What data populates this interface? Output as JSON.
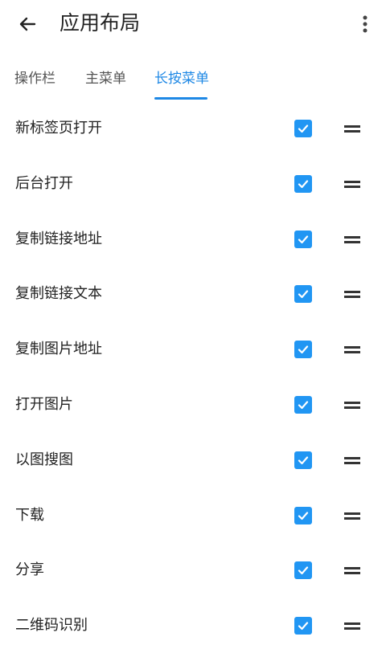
{
  "header": {
    "title": "应用布局",
    "back_icon": "arrow-left-icon",
    "menu_icon": "more-vertical-icon"
  },
  "tabs": [
    {
      "label": "操作栏",
      "active": false
    },
    {
      "label": "主菜单",
      "active": false
    },
    {
      "label": "长按菜单",
      "active": true
    }
  ],
  "colors": {
    "accent": "#1e88e5",
    "checkbox": "#2196f3"
  },
  "items": [
    {
      "label": "新标签页打开",
      "checked": true
    },
    {
      "label": "后台打开",
      "checked": true
    },
    {
      "label": "复制链接地址",
      "checked": true
    },
    {
      "label": "复制链接文本",
      "checked": true
    },
    {
      "label": "复制图片地址",
      "checked": true
    },
    {
      "label": "打开图片",
      "checked": true
    },
    {
      "label": "以图搜图",
      "checked": true
    },
    {
      "label": "下载",
      "checked": true
    },
    {
      "label": "分享",
      "checked": true
    },
    {
      "label": "二维码识别",
      "checked": true
    }
  ]
}
